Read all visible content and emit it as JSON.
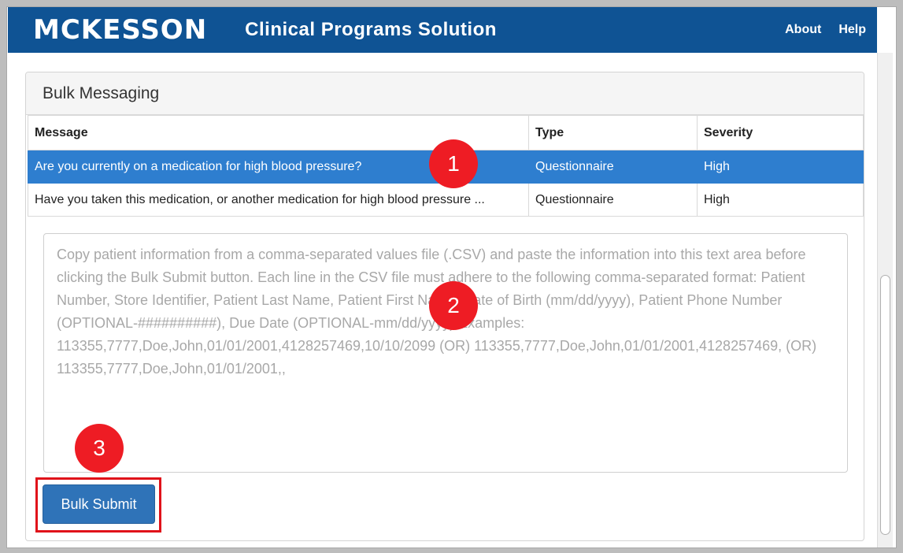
{
  "header": {
    "logo": "MCKESSON",
    "app_title": "Clinical Programs Solution",
    "nav": [
      "About",
      "Help"
    ]
  },
  "panel": {
    "title": "Bulk Messaging"
  },
  "table": {
    "headers": [
      "Message",
      "Type",
      "Severity"
    ],
    "rows": [
      {
        "message": "Are you currently on a medication for high blood pressure?",
        "type": "Questionnaire",
        "severity": "High",
        "selected": true
      },
      {
        "message": "Have you taken this medication, or another medication for high blood pressure ...",
        "type": "Questionnaire",
        "severity": "High",
        "selected": false
      }
    ]
  },
  "textarea": {
    "placeholder": "Copy patient information from a comma-separated values file (.CSV) and paste the information into this text area before clicking the Bulk Submit button. Each line in the CSV file must adhere to the following comma-separated format: Patient Number, Store Identifier, Patient Last Name, Patient First Name, Date of Birth (mm/dd/yyyy), Patient Phone Number (OPTIONAL-##########), Due Date (OPTIONAL-mm/dd/yyyy) Examples:  113355,7777,Doe,John,01/01/2001,4128257469,10/10/2099  (OR) 113355,7777,Doe,John,01/01/2001,4128257469, (OR) 113355,7777,Doe,John,01/01/2001,,"
  },
  "submit_label": "Bulk Submit",
  "callouts": [
    "1",
    "2",
    "3"
  ],
  "colors": {
    "header_bg": "#0f5394",
    "selected_row": "#2e7ecf",
    "button_bg": "#2f73b8",
    "callout": "#ee1c24"
  }
}
